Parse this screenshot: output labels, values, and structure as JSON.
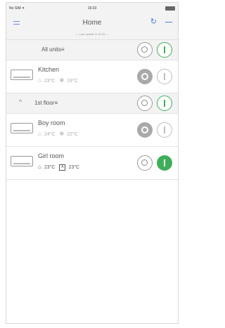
{
  "status_bar": {
    "carrier": "No SIM ✦",
    "time": "16:33"
  },
  "nav": {
    "title": "Home",
    "updated_text": "— Last update in 16:33 —"
  },
  "groups": [
    {
      "label": "All units",
      "suffix": "≡"
    },
    {
      "label": "1st floor",
      "suffix": "≡",
      "chevron": "^"
    }
  ],
  "units": [
    {
      "name": "Kitchen",
      "room_temp": "23°C",
      "set_temp": "19°C",
      "state": "off"
    },
    {
      "name": "Boy room",
      "room_temp": "24°C",
      "set_temp": "22°C",
      "state": "off"
    },
    {
      "name": "Girl room",
      "room_temp": "23°C",
      "set_temp": "23°C",
      "state": "on",
      "fan_mode": "A"
    }
  ],
  "icons": {
    "room_temp": "thermometer-icon",
    "cool_mode": "snowflake-icon",
    "fan_auto": "fan-auto-icon"
  },
  "colors": {
    "accent": "#4a7fd0",
    "on_green": "#3fae5a",
    "off_gray": "#a9a9a9"
  }
}
